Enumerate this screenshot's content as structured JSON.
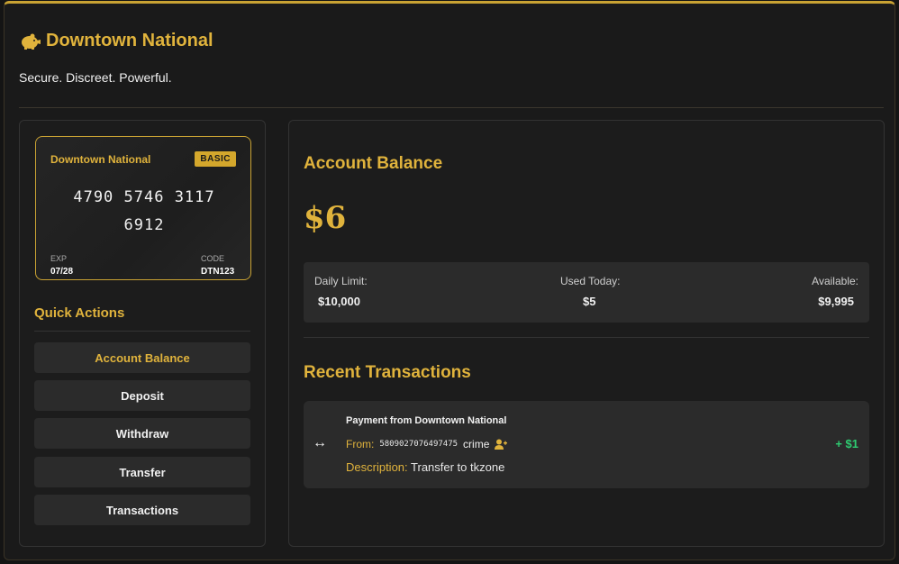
{
  "header": {
    "title": "Downtown National",
    "tagline": "Secure. Discreet. Powerful."
  },
  "card": {
    "bank": "Downtown National",
    "tier": "BASIC",
    "number_line1": "4790 5746 3117",
    "number_line2": "6912",
    "exp_label": "EXP",
    "exp": "07/28",
    "code_label": "CODE",
    "code": "DTN123"
  },
  "quick_actions": {
    "title": "Quick Actions",
    "items": [
      {
        "label": "Account Balance"
      },
      {
        "label": "Deposit"
      },
      {
        "label": "Withdraw"
      },
      {
        "label": "Transfer"
      },
      {
        "label": "Transactions"
      }
    ]
  },
  "balance": {
    "title": "Account Balance",
    "amount": "$6",
    "daily_limit_label": "Daily Limit:",
    "daily_limit": "$10,000",
    "used_label": "Used Today:",
    "used": "$5",
    "available_label": "Available:",
    "available": "$9,995"
  },
  "transactions": {
    "title": "Recent Transactions",
    "items": [
      {
        "icon": "↔",
        "heading": "Payment from Downtown National",
        "from_label": "From:",
        "account": "5809027076497475",
        "user": "crime",
        "desc_label": "Description:",
        "description": "Transfer to tkzone",
        "amount": "+ $1"
      }
    ]
  },
  "colors": {
    "accent": "#e0b33c",
    "positive": "#2ecc71",
    "background": "#1a1a1a"
  }
}
